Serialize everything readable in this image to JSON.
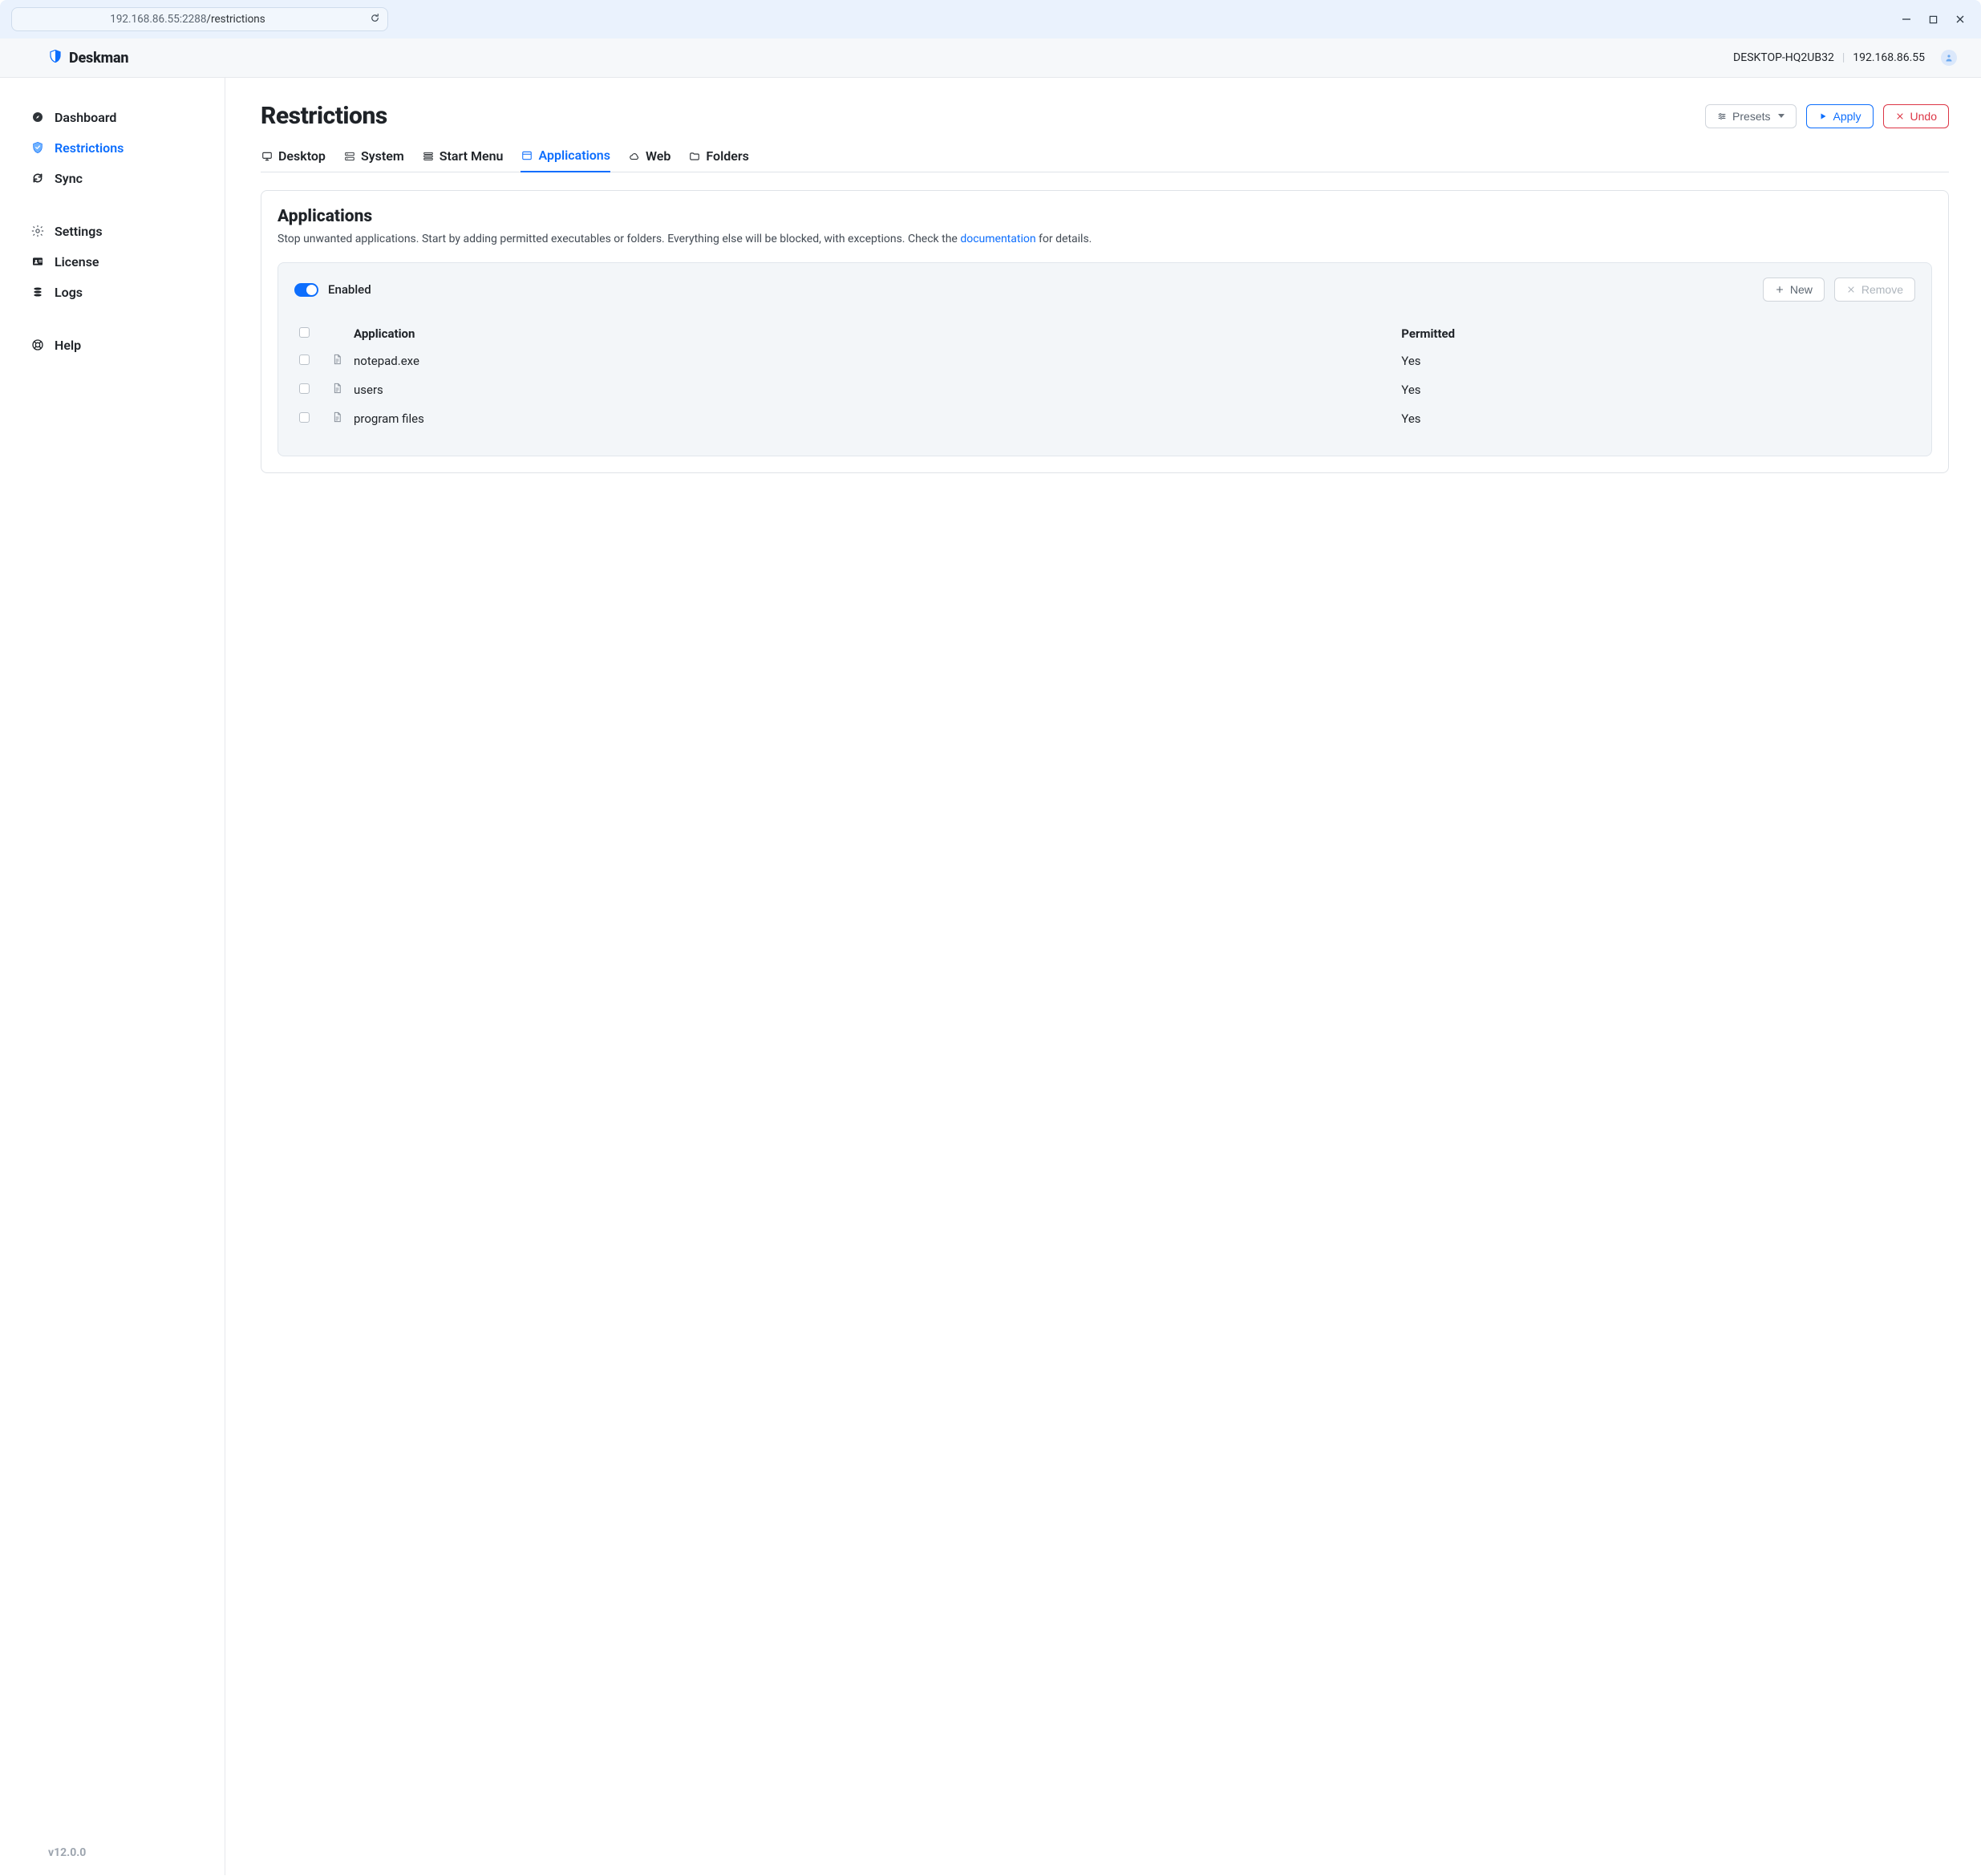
{
  "chrome": {
    "url_host": "192.168.86.55:2288",
    "url_path": "/restrictions"
  },
  "brand": {
    "name": "Deskman"
  },
  "header": {
    "hostname": "DESKTOP-HQ2UB32",
    "ip": "192.168.86.55"
  },
  "sidebar": {
    "groups": [
      {
        "items": [
          {
            "id": "dashboard",
            "label": "Dashboard",
            "icon": "compass",
            "active": false
          },
          {
            "id": "restrictions",
            "label": "Restrictions",
            "icon": "shield-check",
            "active": true
          },
          {
            "id": "sync",
            "label": "Sync",
            "icon": "refresh",
            "active": false
          }
        ]
      },
      {
        "items": [
          {
            "id": "settings",
            "label": "Settings",
            "icon": "gear",
            "active": false
          },
          {
            "id": "license",
            "label": "License",
            "icon": "id-card",
            "active": false
          },
          {
            "id": "logs",
            "label": "Logs",
            "icon": "stack",
            "active": false
          }
        ]
      },
      {
        "items": [
          {
            "id": "help",
            "label": "Help",
            "icon": "life-ring",
            "active": false
          }
        ]
      }
    ]
  },
  "version": "v12.0.0",
  "page": {
    "title": "Restrictions",
    "toolbar": {
      "presets_label": "Presets",
      "apply_label": "Apply",
      "undo_label": "Undo"
    },
    "tabs": [
      {
        "id": "desktop",
        "label": "Desktop",
        "active": false
      },
      {
        "id": "system",
        "label": "System",
        "active": false
      },
      {
        "id": "startmenu",
        "label": "Start Menu",
        "active": false
      },
      {
        "id": "applications",
        "label": "Applications",
        "active": true
      },
      {
        "id": "web",
        "label": "Web",
        "active": false
      },
      {
        "id": "folders",
        "label": "Folders",
        "active": false
      }
    ]
  },
  "applications": {
    "heading": "Applications",
    "description_pre": "Stop unwanted applications. Start by adding permitted executables or folders. Everything else will be blocked, with exceptions. Check the ",
    "documentation_link": "documentation",
    "description_post": " for details.",
    "enabled_label": "Enabled",
    "enabled": true,
    "new_label": "New",
    "remove_label": "Remove",
    "columns": {
      "application": "Application",
      "permitted": "Permitted"
    },
    "rows": [
      {
        "application": "notepad.exe",
        "permitted": "Yes"
      },
      {
        "application": "users",
        "permitted": "Yes"
      },
      {
        "application": "program files",
        "permitted": "Yes"
      }
    ]
  }
}
